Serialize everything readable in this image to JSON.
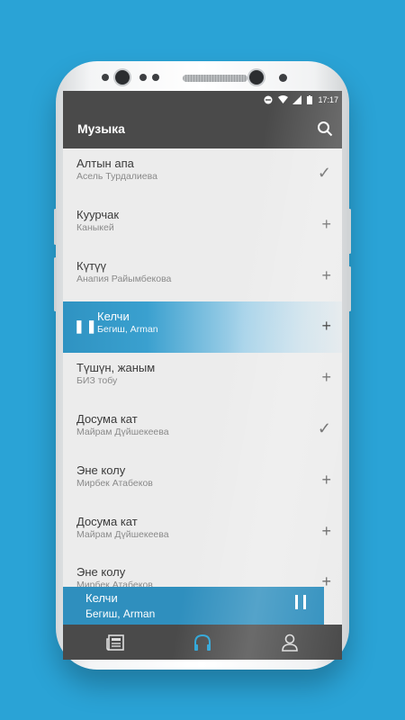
{
  "status_bar": {
    "time": "17:17"
  },
  "app_bar": {
    "title": "Музыка",
    "search_icon": "search-icon"
  },
  "songs": [
    {
      "title": "Алтын апа",
      "artist": "Асель Турдалиева",
      "action": "✓"
    },
    {
      "title": "Куурчак",
      "artist": "Каныкей",
      "action": "+"
    },
    {
      "title": "Күтүү",
      "artist": "Анапия Райымбекова",
      "action": "+"
    },
    {
      "title": "Келчи",
      "artist": "Бегиш, Arman",
      "action": "+",
      "playing": true
    },
    {
      "title": "Түшүн, жаным",
      "artist": "БИЗ тобу",
      "action": "+"
    },
    {
      "title": "Досума кат",
      "artist": "Майрам Дүйшекеева",
      "action": "✓"
    },
    {
      "title": "Эне колу",
      "artist": "Мирбек Атабеков",
      "action": "+"
    },
    {
      "title": "Досума кат",
      "artist": "Майрам Дүйшекеева",
      "action": "+"
    },
    {
      "title": "Эне колу",
      "artist": "Мирбек Атабеков",
      "action": "+"
    }
  ],
  "now_playing": {
    "title": "Келчи",
    "artist": "Бегиш, Arman"
  },
  "tabs": [
    {
      "icon": "news-icon",
      "active": false
    },
    {
      "icon": "headphones-icon",
      "active": true
    },
    {
      "icon": "profile-icon",
      "active": false
    }
  ],
  "colors": {
    "background": "#2aa3d6",
    "toolbar": "#4a4a4a",
    "accent": "#2f8fbe",
    "active_tab": "#2aa3d6"
  }
}
